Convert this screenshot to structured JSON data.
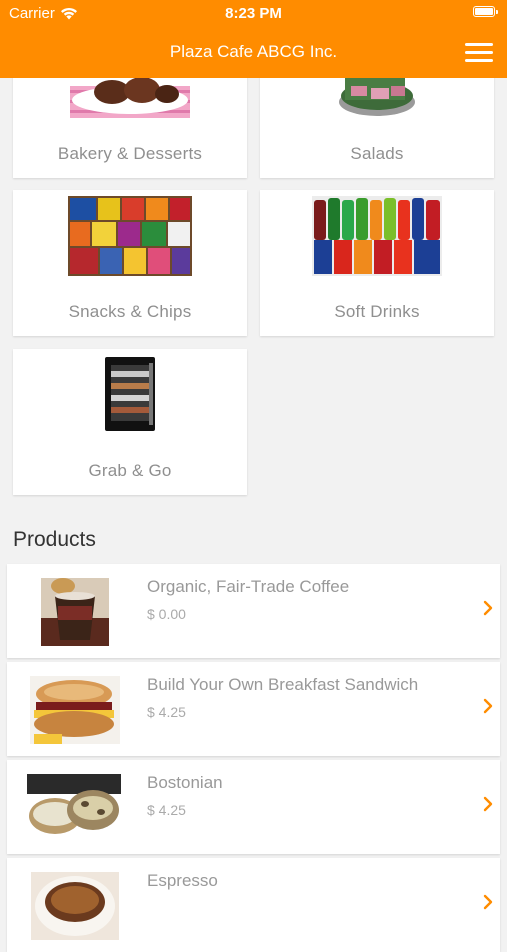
{
  "status_bar": {
    "carrier": "Carrier",
    "time": "8:23 PM"
  },
  "header": {
    "title": "Plaza Cafe ABCG Inc."
  },
  "categories": [
    {
      "label": "Bakery & Desserts",
      "icon": "bakery-image"
    },
    {
      "label": "Salads",
      "icon": "salad-image"
    },
    {
      "label": "Snacks & Chips",
      "icon": "snacks-image"
    },
    {
      "label": "Soft Drinks",
      "icon": "soft-drinks-image"
    },
    {
      "label": "Grab & Go",
      "icon": "grab-and-go-fridge-image"
    }
  ],
  "products_section": {
    "title": "Products"
  },
  "products": [
    {
      "name": "Organic, Fair-Trade Coffee",
      "price": "$ 0.00",
      "icon": "coffee-cup-image"
    },
    {
      "name": "Build Your Own Breakfast Sandwich",
      "price": "$ 4.25",
      "icon": "bagel-sandwich-image"
    },
    {
      "name": "Bostonian",
      "price": "$ 4.25",
      "icon": "bagel-image"
    },
    {
      "name": "Espresso",
      "price": "",
      "icon": "espresso-cup-image"
    }
  ],
  "colors": {
    "brand": "#ff8c00",
    "background": "#f2f2f2",
    "card": "#ffffff",
    "label_text": "#8f8f8f",
    "chevron": "#ff8c00"
  }
}
